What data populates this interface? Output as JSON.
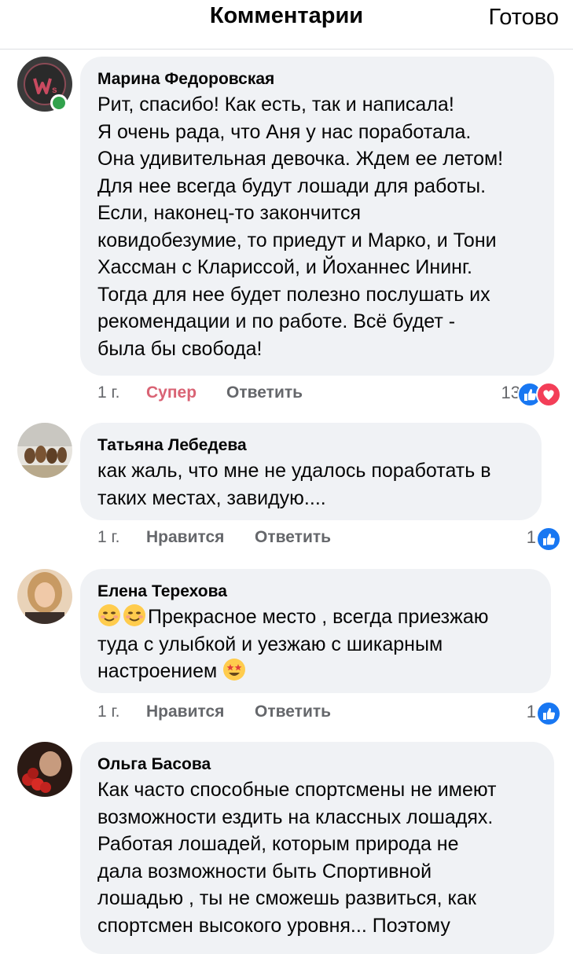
{
  "header": {
    "title": "Комментарии",
    "done_label": "Готово"
  },
  "comments": [
    {
      "author": "Марина Федоровская",
      "text": "Рит, спасибо! Как есть, так и написала!\nЯ очень рада, что Аня у нас поработала.\nОна удивительная девочка. Ждем ее летом!\nДля нее всегда будут лошади для работы.\nЕсли, наконец-то закончится\nковидобезумие, то приедут и Марко, и Тони\nХассман с Клариссой,  и Йоханнес Ининг.\nТогда для нее будет полезно послушать их\nрекомендации и по работе. Всё будет -\nбыла бы свобода!",
      "time": "1 г.",
      "reaction_label": "Супер",
      "reply_label": "Ответить",
      "reaction_count": "13",
      "online": true
    },
    {
      "author": "Татьяна Лебедева",
      "text": "как жаль, что мне не удалось поработать в\nтаких местах, завидую....",
      "time": "1 г.",
      "reaction_label": "Нравится",
      "reply_label": "Ответить",
      "reaction_count": "1"
    },
    {
      "author": "Елена Терехова",
      "text": "Прекрасное место , всегда приезжаю\nтуда с улыбкой и уезжаю с шикарным\nнастроением",
      "time": "1 г.",
      "reaction_label": "Нравится",
      "reply_label": "Ответить",
      "reaction_count": "1"
    },
    {
      "author": "Ольга Басова",
      "text": "Как часто способные спортсмены не имеют\nвозможности ездить на классных лошадях.\nРаботая лошадей, которым природа не\nдала возможности быть Спортивной\nлошадью , ты не сможешь развиться, как\nспортсмен высокого уровня... Поэтому"
    }
  ],
  "colors": {
    "bubble": "#f0f2f5",
    "meta_text": "#65676b",
    "super_reaction": "#d96374",
    "like_blue": "#1877f2",
    "love_red": "#f33e58",
    "online_green": "#31a24c"
  },
  "icons": [
    "like-reaction-icon",
    "love-reaction-icon",
    "smiling-face-emoji",
    "star-struck-emoji"
  ]
}
